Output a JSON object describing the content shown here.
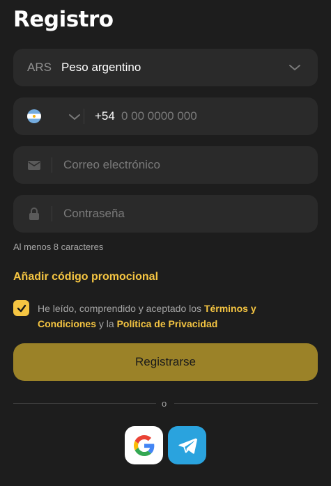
{
  "title": "Registro",
  "currency": {
    "code": "ARS",
    "name": "Peso argentino"
  },
  "phone": {
    "dial_code": "+54",
    "placeholder": "0 00 0000 000"
  },
  "email": {
    "placeholder": "Correo electrónico"
  },
  "password": {
    "placeholder": "Contraseña",
    "hint": "Al menos 8 caracteres"
  },
  "promo_link": "Añadir código promocional",
  "consent": {
    "checked": true,
    "text_1": "He leído, comprendido y aceptado los ",
    "terms_link": "Términos y Condiciones",
    "text_2": " y la ",
    "privacy_link": "Política de Privacidad"
  },
  "register_button": "Registrarse",
  "divider_text": "o",
  "social": [
    "google-icon",
    "telegram-icon"
  ],
  "colors": {
    "background": "#1d1d1d",
    "field": "#2a2a2a",
    "accent": "#f5c542",
    "button": "#9b8228",
    "telegram": "#2aa3de"
  }
}
